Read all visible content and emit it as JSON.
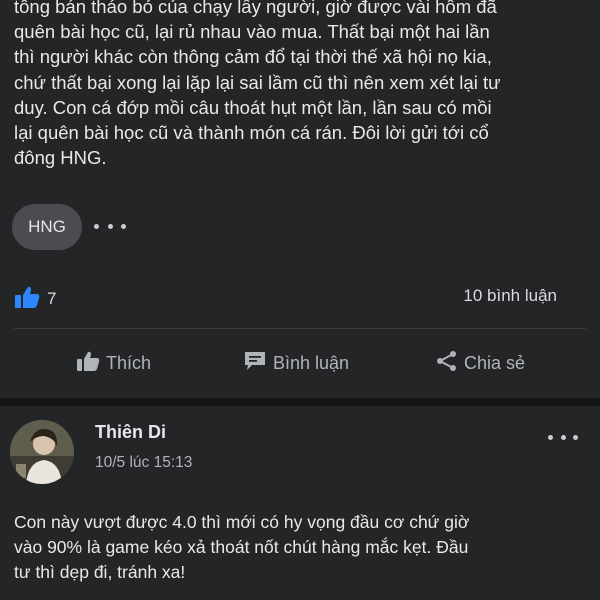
{
  "post": {
    "body_lines": [
      "tông bán tháo bỏ của chạy lấy người, giờ được vài hôm đã",
      "quên bài học cũ, lại rủ nhau vào mua. Thất bại một hai lần",
      "thì người khác còn thông cảm đổ tại thời thế xã hội nọ kia,",
      "chứ thất bại xong lại lặp lại sai lầm cũ thì nên xem xét lại tư",
      "duy. Con cá đớp mồi câu thoát hụt một lần, lần sau có mồi",
      "lại quên bài học cũ và thành món cá rán. Đôi lời gửi tới cổ",
      "đông HNG."
    ],
    "tag": "HNG",
    "like_count": "7",
    "comment_count": "10 bình luận",
    "actions": {
      "like": "Thích",
      "comment": "Bình luận",
      "share": "Chia sẻ"
    }
  },
  "comment": {
    "author": "Thiên Di",
    "timestamp": "10/5 lúc 15:13",
    "text_lines": [
      "Con này vượt được 4.0 thì mới có hy vọng đầu cơ chứ giờ",
      "vào 90% là game kéo xả thoát nốt chút hàng mắc kẹt. Đầu",
      "tư thì dẹp đi, tránh xa!"
    ]
  },
  "colors": {
    "accent": "#2d88ff",
    "card_bg": "#242527",
    "separator": "#151617",
    "text_primary": "#e4e6eb",
    "text_secondary": "#b0b3b8"
  },
  "icons": {
    "like_reaction": "thumbs-up-icon",
    "like_action": "thumbs-up-outline-icon",
    "comment_action": "speech-bubble-icon",
    "share_action": "share-icon",
    "more": "more-dots-icon"
  }
}
